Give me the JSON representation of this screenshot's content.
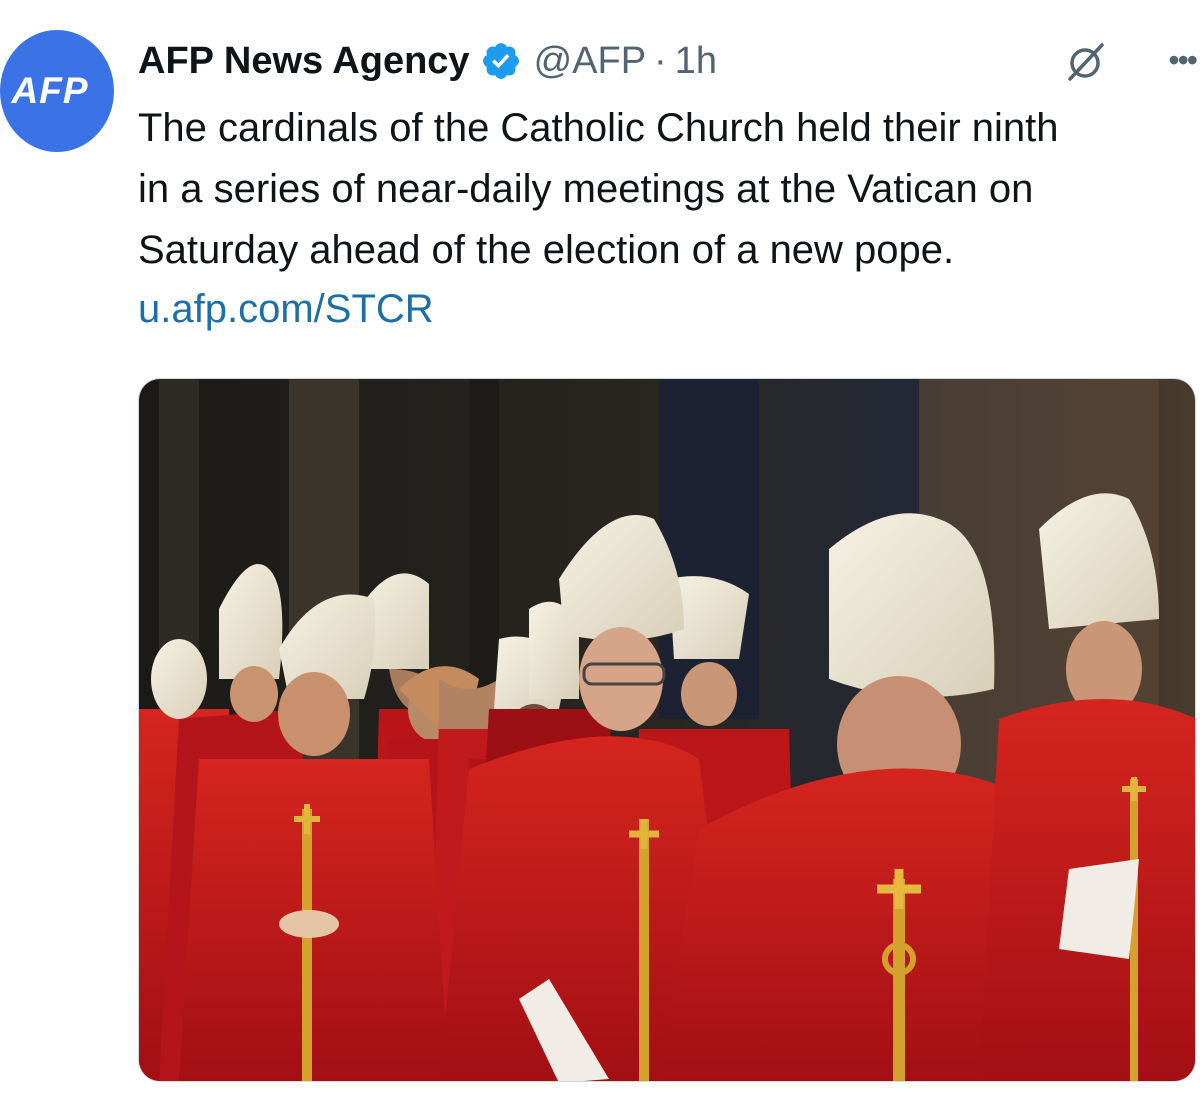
{
  "author": {
    "avatar_text": "AFP",
    "display_name": "AFP News Agency",
    "handle": "@AFP",
    "separator": "·",
    "time": "1h",
    "verified_color": "#1d9bf0"
  },
  "tweet": {
    "lines": [
      "The cardinals of the Catholic Church held their ninth",
      "in a series of near-daily meetings at the Vatican on",
      "Saturday ahead of the election of a new pope."
    ],
    "link": "u.afp.com/STCR"
  },
  "colors": {
    "avatar_bg": "#3b73e6",
    "link": "#1d6fa5",
    "robe_red": "#c8161d",
    "mitre_cream": "#ece6d6",
    "gold": "#d4a22c"
  },
  "icons": {
    "verified": "verified-badge-icon",
    "grok": "grok-icon",
    "more": "more-options-icon"
  }
}
